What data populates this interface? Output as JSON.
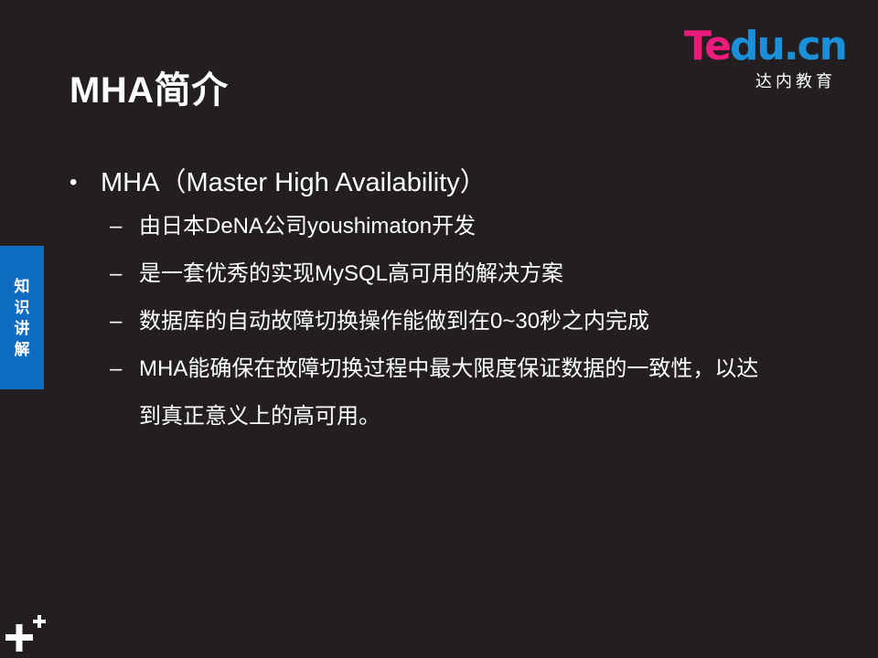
{
  "slide": {
    "title": "MHA简介",
    "logo": {
      "word_part1": "Te",
      "word_part2": "du.cn",
      "subtitle": "达内教育"
    },
    "side_tab": [
      "知",
      "识",
      "讲",
      "解"
    ],
    "bullet": {
      "marker": "•",
      "text": "MHA（Master High Availability）"
    },
    "sub_marker": "–",
    "sub_items": [
      "由日本DeNA公司youshimaton开发",
      "是一套优秀的实现MySQL高可用的解决方案",
      "数据库的自动故障切换操作能做到在0~30秒之内完成",
      "MHA能确保在故障切换过程中最大限度保证数据的一致性，以达到真正意义上的高可用。"
    ]
  },
  "colors": {
    "background": "#231f20",
    "logo_pink": "#ec1c7c",
    "logo_blue": "#1b8fd8",
    "tab_blue": "#0f6cc3",
    "text": "#ffffff"
  },
  "icons": {
    "corner": "plus-icon"
  }
}
